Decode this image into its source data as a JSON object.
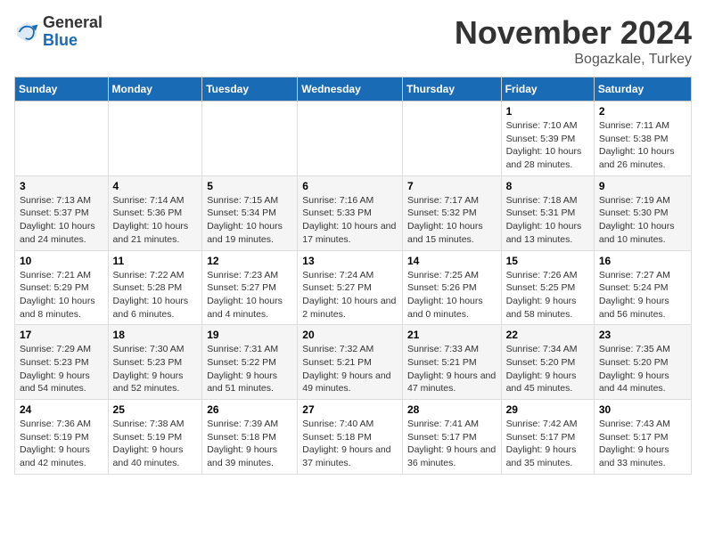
{
  "logo": {
    "general": "General",
    "blue": "Blue"
  },
  "header": {
    "month": "November 2024",
    "location": "Bogazkale, Turkey"
  },
  "weekdays": [
    "Sunday",
    "Monday",
    "Tuesday",
    "Wednesday",
    "Thursday",
    "Friday",
    "Saturday"
  ],
  "weeks": [
    [
      {
        "day": "",
        "info": ""
      },
      {
        "day": "",
        "info": ""
      },
      {
        "day": "",
        "info": ""
      },
      {
        "day": "",
        "info": ""
      },
      {
        "day": "",
        "info": ""
      },
      {
        "day": "1",
        "info": "Sunrise: 7:10 AM\nSunset: 5:39 PM\nDaylight: 10 hours and 28 minutes."
      },
      {
        "day": "2",
        "info": "Sunrise: 7:11 AM\nSunset: 5:38 PM\nDaylight: 10 hours and 26 minutes."
      }
    ],
    [
      {
        "day": "3",
        "info": "Sunrise: 7:13 AM\nSunset: 5:37 PM\nDaylight: 10 hours and 24 minutes."
      },
      {
        "day": "4",
        "info": "Sunrise: 7:14 AM\nSunset: 5:36 PM\nDaylight: 10 hours and 21 minutes."
      },
      {
        "day": "5",
        "info": "Sunrise: 7:15 AM\nSunset: 5:34 PM\nDaylight: 10 hours and 19 minutes."
      },
      {
        "day": "6",
        "info": "Sunrise: 7:16 AM\nSunset: 5:33 PM\nDaylight: 10 hours and 17 minutes."
      },
      {
        "day": "7",
        "info": "Sunrise: 7:17 AM\nSunset: 5:32 PM\nDaylight: 10 hours and 15 minutes."
      },
      {
        "day": "8",
        "info": "Sunrise: 7:18 AM\nSunset: 5:31 PM\nDaylight: 10 hours and 13 minutes."
      },
      {
        "day": "9",
        "info": "Sunrise: 7:19 AM\nSunset: 5:30 PM\nDaylight: 10 hours and 10 minutes."
      }
    ],
    [
      {
        "day": "10",
        "info": "Sunrise: 7:21 AM\nSunset: 5:29 PM\nDaylight: 10 hours and 8 minutes."
      },
      {
        "day": "11",
        "info": "Sunrise: 7:22 AM\nSunset: 5:28 PM\nDaylight: 10 hours and 6 minutes."
      },
      {
        "day": "12",
        "info": "Sunrise: 7:23 AM\nSunset: 5:27 PM\nDaylight: 10 hours and 4 minutes."
      },
      {
        "day": "13",
        "info": "Sunrise: 7:24 AM\nSunset: 5:27 PM\nDaylight: 10 hours and 2 minutes."
      },
      {
        "day": "14",
        "info": "Sunrise: 7:25 AM\nSunset: 5:26 PM\nDaylight: 10 hours and 0 minutes."
      },
      {
        "day": "15",
        "info": "Sunrise: 7:26 AM\nSunset: 5:25 PM\nDaylight: 9 hours and 58 minutes."
      },
      {
        "day": "16",
        "info": "Sunrise: 7:27 AM\nSunset: 5:24 PM\nDaylight: 9 hours and 56 minutes."
      }
    ],
    [
      {
        "day": "17",
        "info": "Sunrise: 7:29 AM\nSunset: 5:23 PM\nDaylight: 9 hours and 54 minutes."
      },
      {
        "day": "18",
        "info": "Sunrise: 7:30 AM\nSunset: 5:23 PM\nDaylight: 9 hours and 52 minutes."
      },
      {
        "day": "19",
        "info": "Sunrise: 7:31 AM\nSunset: 5:22 PM\nDaylight: 9 hours and 51 minutes."
      },
      {
        "day": "20",
        "info": "Sunrise: 7:32 AM\nSunset: 5:21 PM\nDaylight: 9 hours and 49 minutes."
      },
      {
        "day": "21",
        "info": "Sunrise: 7:33 AM\nSunset: 5:21 PM\nDaylight: 9 hours and 47 minutes."
      },
      {
        "day": "22",
        "info": "Sunrise: 7:34 AM\nSunset: 5:20 PM\nDaylight: 9 hours and 45 minutes."
      },
      {
        "day": "23",
        "info": "Sunrise: 7:35 AM\nSunset: 5:20 PM\nDaylight: 9 hours and 44 minutes."
      }
    ],
    [
      {
        "day": "24",
        "info": "Sunrise: 7:36 AM\nSunset: 5:19 PM\nDaylight: 9 hours and 42 minutes."
      },
      {
        "day": "25",
        "info": "Sunrise: 7:38 AM\nSunset: 5:19 PM\nDaylight: 9 hours and 40 minutes."
      },
      {
        "day": "26",
        "info": "Sunrise: 7:39 AM\nSunset: 5:18 PM\nDaylight: 9 hours and 39 minutes."
      },
      {
        "day": "27",
        "info": "Sunrise: 7:40 AM\nSunset: 5:18 PM\nDaylight: 9 hours and 37 minutes."
      },
      {
        "day": "28",
        "info": "Sunrise: 7:41 AM\nSunset: 5:17 PM\nDaylight: 9 hours and 36 minutes."
      },
      {
        "day": "29",
        "info": "Sunrise: 7:42 AM\nSunset: 5:17 PM\nDaylight: 9 hours and 35 minutes."
      },
      {
        "day": "30",
        "info": "Sunrise: 7:43 AM\nSunset: 5:17 PM\nDaylight: 9 hours and 33 minutes."
      }
    ]
  ]
}
